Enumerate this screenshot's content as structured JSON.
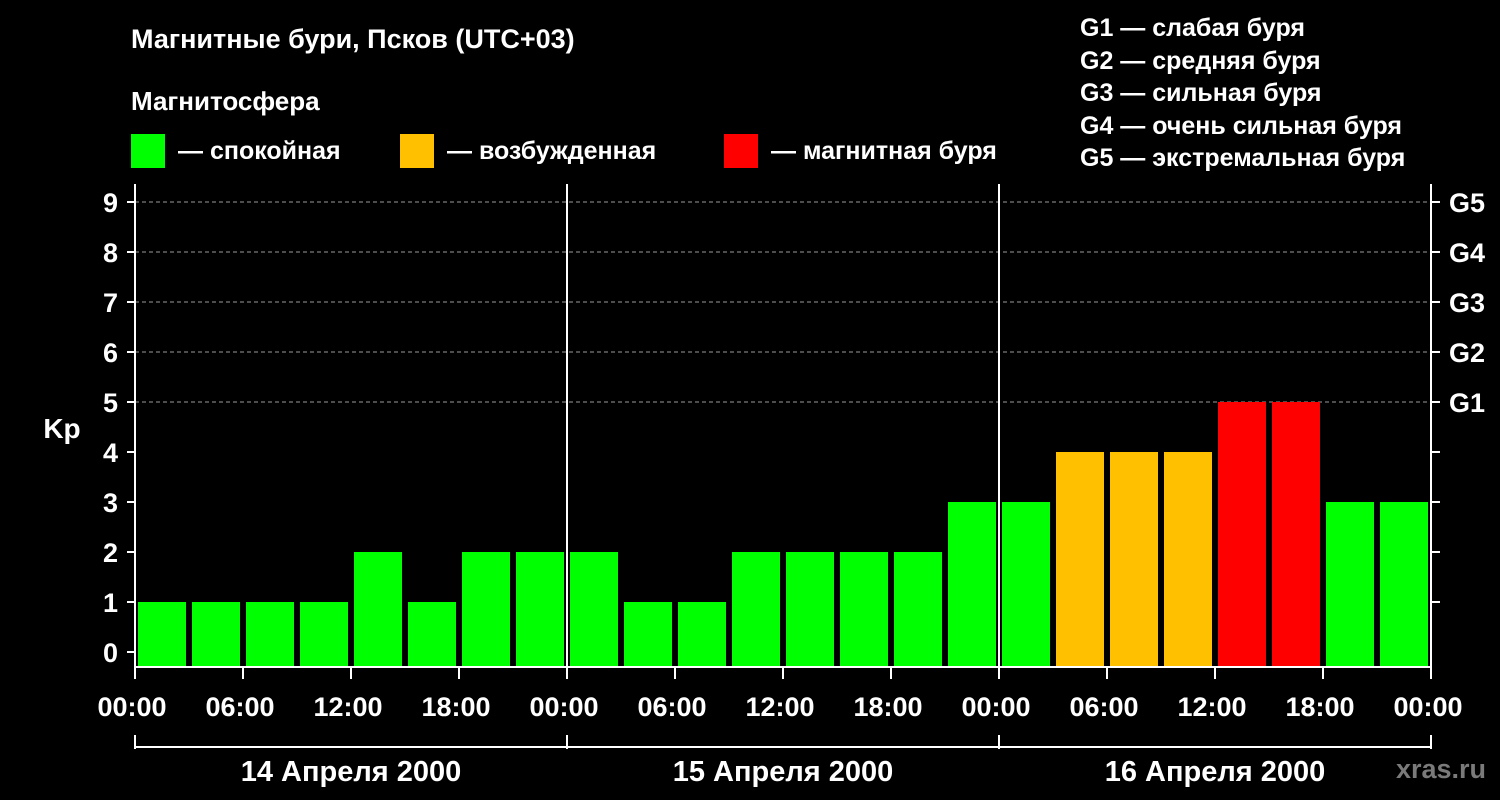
{
  "title": "Магнитные бури, Псков (UTC+03)",
  "subtitle": "Магнитосфера",
  "legend": [
    {
      "label": "— спокойная",
      "color": "#00ff00"
    },
    {
      "label": "— возбужденная",
      "color": "#ffc000"
    },
    {
      "label": "— магнитная буря",
      "color": "#ff0000"
    }
  ],
  "storm_scale": [
    "G1 — слабая буря",
    "G2 — средняя буря",
    "G3 — сильная буря",
    "G4 — очень сильная буря",
    "G5 — экстремальная буря"
  ],
  "watermark": "xras.ru",
  "chart_data": {
    "type": "bar",
    "ylabel": "Kp",
    "ylim": [
      0,
      9
    ],
    "yticks": [
      0,
      1,
      2,
      3,
      4,
      5,
      6,
      7,
      8,
      9
    ],
    "right_ticks": [
      {
        "value": 5,
        "label": "G1"
      },
      {
        "value": 6,
        "label": "G2"
      },
      {
        "value": 7,
        "label": "G3"
      },
      {
        "value": 8,
        "label": "G4"
      },
      {
        "value": 9,
        "label": "G5"
      }
    ],
    "x_tick_labels": [
      "00:00",
      "06:00",
      "12:00",
      "18:00",
      "00:00",
      "06:00",
      "12:00",
      "18:00",
      "00:00",
      "06:00",
      "12:00",
      "18:00",
      "00:00"
    ],
    "days": [
      "14 Апреля 2000",
      "15 Апреля 2000",
      "16 Апреля 2000"
    ],
    "values": [
      1,
      1,
      1,
      1,
      2,
      1,
      2,
      2,
      2,
      1,
      1,
      2,
      2,
      2,
      2,
      3,
      3,
      4,
      4,
      4,
      5,
      5,
      3,
      3
    ],
    "colors": {
      "quiet": "#00ff00",
      "disturbed": "#ffc000",
      "storm": "#ff0000"
    },
    "grid": "dashed horizontal lines at Kp 5–9"
  }
}
